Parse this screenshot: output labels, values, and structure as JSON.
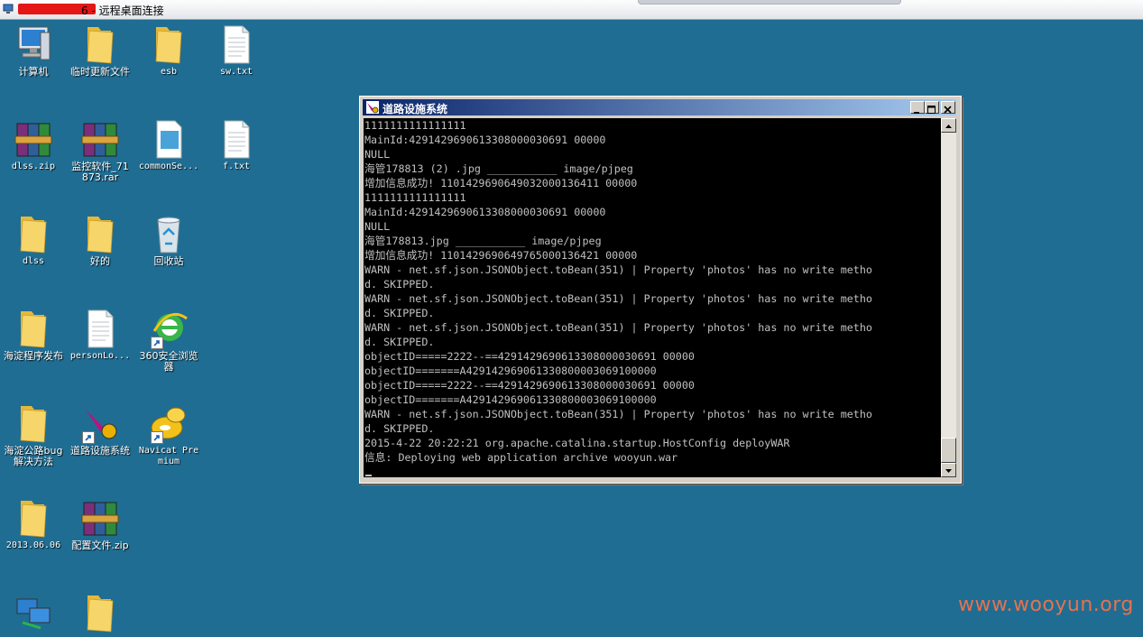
{
  "rdp": {
    "title_suffix": "6 - 远程桌面连接"
  },
  "desktop": {
    "icons": [
      {
        "id": "computer",
        "label": "计算机"
      },
      {
        "id": "temp-update",
        "label": "临时更新文件"
      },
      {
        "id": "esb",
        "label": "esb"
      },
      {
        "id": "sw-txt",
        "label": "sw.txt"
      },
      {
        "id": "dlss-zip",
        "label": "dlss.zip"
      },
      {
        "id": "monitor-rar",
        "label": "监控软件_71873.rar"
      },
      {
        "id": "commonse",
        "label": "commonSe..."
      },
      {
        "id": "f-txt",
        "label": "f.txt"
      },
      {
        "id": "dlss",
        "label": "dlss"
      },
      {
        "id": "haode",
        "label": "好的"
      },
      {
        "id": "recycle",
        "label": "回收站"
      },
      {
        "id": "haidian-release",
        "label": "海淀程序发布"
      },
      {
        "id": "personlo",
        "label": "personLo..."
      },
      {
        "id": "browser-360",
        "label": "360安全浏览器"
      },
      {
        "id": "haidian-bug",
        "label": "海淀公路bug解决方法"
      },
      {
        "id": "road-system",
        "label": "道路设施系统"
      },
      {
        "id": "navicat",
        "label": "Navicat Premium"
      },
      {
        "id": "folder-2013",
        "label": "2013.06.06"
      },
      {
        "id": "config-zip",
        "label": "配置文件.zip"
      },
      {
        "id": "network",
        "label": ""
      },
      {
        "id": "folder-bottom",
        "label": ""
      }
    ]
  },
  "console_window": {
    "title": "道路设施系统",
    "lines": [
      "1111111111111111",
      "MainId:4291429690613308000030691 00000",
      "NULL",
      "海管178813 (2) .jpg ___________ image/pjpeg",
      "增加信息成功! 1101429690649032000136411 00000",
      "1111111111111111",
      "MainId:4291429690613308000030691 00000",
      "NULL",
      "海管178813.jpg ___________ image/pjpeg",
      "增加信息成功! 1101429690649765000136421 00000",
      "WARN - net.sf.json.JSONObject.toBean(351) | Property 'photos' has no write metho",
      "d. SKIPPED.",
      "WARN - net.sf.json.JSONObject.toBean(351) | Property 'photos' has no write metho",
      "d. SKIPPED.",
      "WARN - net.sf.json.JSONObject.toBean(351) | Property 'photos' has no write metho",
      "d. SKIPPED.",
      "objectID=====2222--==4291429690613308000030691 00000",
      "objectID=======A429142969061330800003069100000",
      "objectID=====2222--==4291429690613308000030691 00000",
      "objectID=======A429142969061330800003069100000",
      "WARN - net.sf.json.JSONObject.toBean(351) | Property 'photos' has no write metho",
      "d. SKIPPED.",
      "2015-4-22 20:22:21 org.apache.catalina.startup.HostConfig deployWAR",
      "信息: Deploying web application archive wooyun.war"
    ]
  },
  "watermark": "www.wooyun.org"
}
